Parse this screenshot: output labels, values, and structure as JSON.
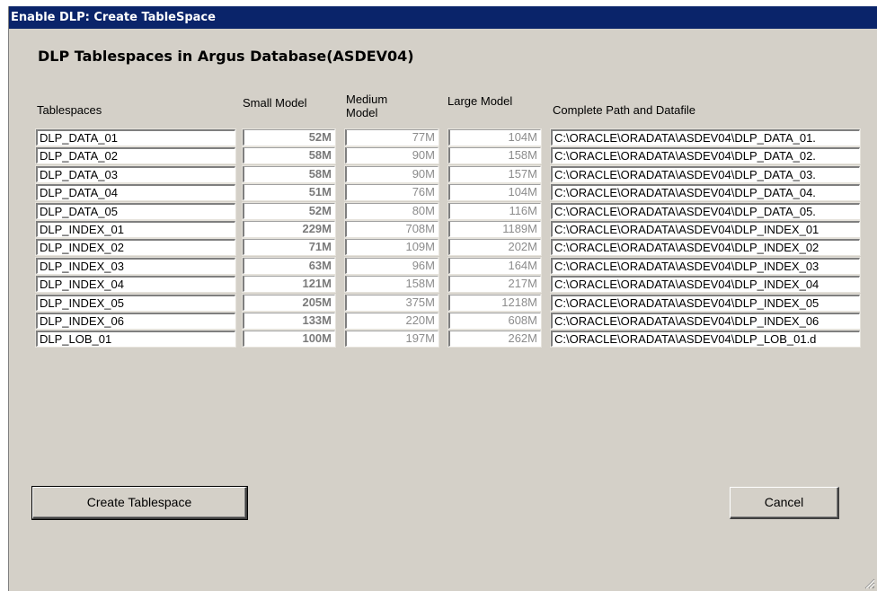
{
  "window": {
    "title": "Enable DLP: Create TableSpace"
  },
  "heading": "DLP Tablespaces in Argus Database(ASDEV04)",
  "columns": {
    "tablespaces": "Tablespaces",
    "small": "Small Model",
    "medium_l1": "Medium",
    "medium_l2": "Model",
    "large": "Large Model",
    "path": "Complete Path and Datafile"
  },
  "rows": [
    {
      "name": "DLP_DATA_01",
      "small": "52M",
      "medium": "77M",
      "large": "104M",
      "path": "C:\\ORACLE\\ORADATA\\ASDEV04\\DLP_DATA_01."
    },
    {
      "name": "DLP_DATA_02",
      "small": "58M",
      "medium": "90M",
      "large": "158M",
      "path": "C:\\ORACLE\\ORADATA\\ASDEV04\\DLP_DATA_02."
    },
    {
      "name": "DLP_DATA_03",
      "small": "58M",
      "medium": "90M",
      "large": "157M",
      "path": "C:\\ORACLE\\ORADATA\\ASDEV04\\DLP_DATA_03."
    },
    {
      "name": "DLP_DATA_04",
      "small": "51M",
      "medium": "76M",
      "large": "104M",
      "path": "C:\\ORACLE\\ORADATA\\ASDEV04\\DLP_DATA_04."
    },
    {
      "name": "DLP_DATA_05",
      "small": "52M",
      "medium": "80M",
      "large": "116M",
      "path": "C:\\ORACLE\\ORADATA\\ASDEV04\\DLP_DATA_05."
    },
    {
      "name": "DLP_INDEX_01",
      "small": "229M",
      "medium": "708M",
      "large": "1189M",
      "path": "C:\\ORACLE\\ORADATA\\ASDEV04\\DLP_INDEX_01"
    },
    {
      "name": "DLP_INDEX_02",
      "small": "71M",
      "medium": "109M",
      "large": "202M",
      "path": "C:\\ORACLE\\ORADATA\\ASDEV04\\DLP_INDEX_02"
    },
    {
      "name": "DLP_INDEX_03",
      "small": "63M",
      "medium": "96M",
      "large": "164M",
      "path": "C:\\ORACLE\\ORADATA\\ASDEV04\\DLP_INDEX_03"
    },
    {
      "name": "DLP_INDEX_04",
      "small": "121M",
      "medium": "158M",
      "large": "217M",
      "path": "C:\\ORACLE\\ORADATA\\ASDEV04\\DLP_INDEX_04"
    },
    {
      "name": "DLP_INDEX_05",
      "small": "205M",
      "medium": "375M",
      "large": "1218M",
      "path": "C:\\ORACLE\\ORADATA\\ASDEV04\\DLP_INDEX_05"
    },
    {
      "name": "DLP_INDEX_06",
      "small": "133M",
      "medium": "220M",
      "large": "608M",
      "path": "C:\\ORACLE\\ORADATA\\ASDEV04\\DLP_INDEX_06"
    },
    {
      "name": "DLP_LOB_01",
      "small": "100M",
      "medium": "197M",
      "large": "262M",
      "path": "C:\\ORACLE\\ORADATA\\ASDEV04\\DLP_LOB_01.d"
    }
  ],
  "buttons": {
    "create": "Create Tablespace",
    "cancel": "Cancel"
  },
  "colors": {
    "titlebar": "#0a246a",
    "dialog_bg": "#d4d0c8"
  },
  "icons": {
    "resize": "resize-grip-icon"
  }
}
